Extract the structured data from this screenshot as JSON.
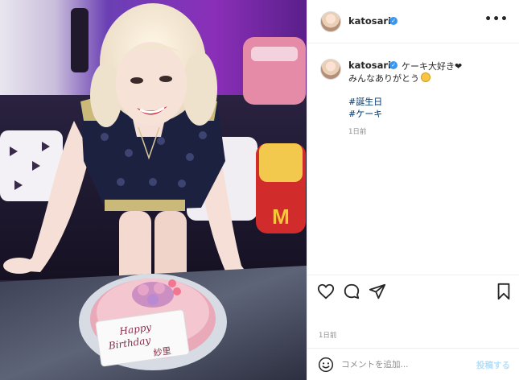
{
  "post": {
    "username": "katosari",
    "comment_username": "katosari",
    "caption_line1": "ケーキ大好き❤",
    "caption_line2": "みんなありがとう",
    "hashtags": [
      "#誕生日",
      "#ケーキ"
    ],
    "comment_time": "1日前",
    "post_time": "1日前",
    "verified_mark": "✓",
    "more_label": "•••"
  },
  "photo": {
    "cake_text_line1": "Happy",
    "cake_text_line2": "Birthday",
    "cake_text_line3": "紗里",
    "sofa_logo": "M"
  },
  "comment_bar": {
    "placeholder": "コメントを追加...",
    "post_label": "投稿する"
  },
  "icons": {
    "like": "heart-icon",
    "comment": "comment-icon",
    "share": "share-icon",
    "save": "bookmark-icon",
    "emoji": "smiley-icon"
  },
  "colors": {
    "link": "#00376b",
    "verified": "#3897f0",
    "muted": "#8e8e8e",
    "post_button": "#b2dffc"
  }
}
